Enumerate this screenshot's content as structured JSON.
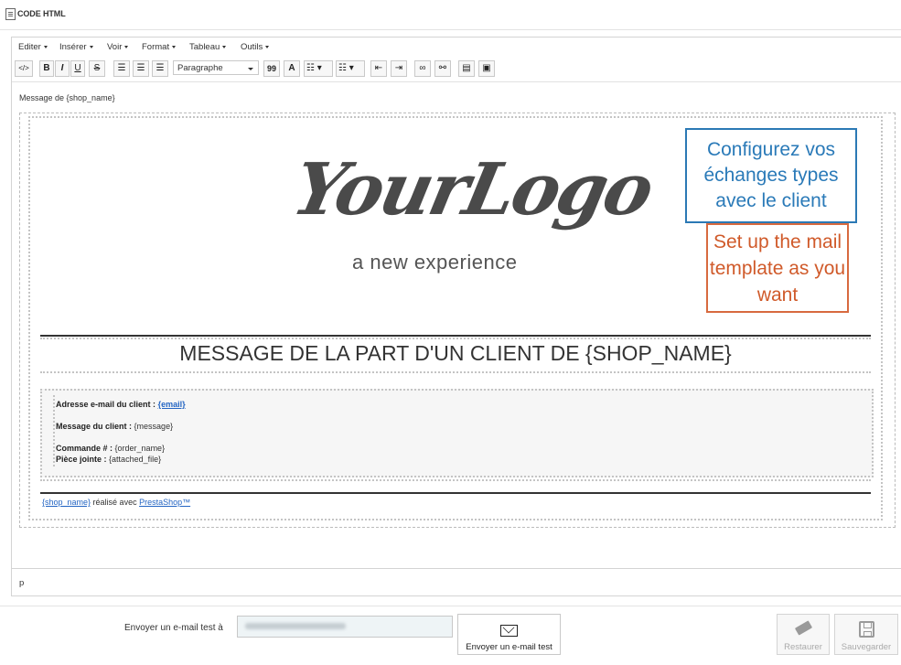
{
  "header": {
    "title": "CODE HTML"
  },
  "menubar": {
    "items": [
      "Editer",
      "Insérer",
      "Voir",
      "Format",
      "Tableau",
      "Outils"
    ]
  },
  "toolbar": {
    "bold": "B",
    "italic": "I",
    "underline": "U",
    "strike": "S",
    "format_select": "Paragraphe",
    "quote": "99",
    "font": "A"
  },
  "editor": {
    "message_label": "Message de {shop_name}",
    "logo_main": "YourLogo",
    "logo_sub": "a new experience",
    "callout_fr": "Configurez vos échanges types avec le client",
    "callout_en": "Set up the mail template as you want",
    "heading": "MESSAGE DE LA PART D'UN CLIENT DE {SHOP_NAME}",
    "details": {
      "email_label": "Adresse e-mail du client :",
      "email_value": "{email}",
      "message_label": "Message du client :",
      "message_value": "{message}",
      "order_label": "Commande # :",
      "order_value": "{order_name}",
      "attachment_label": "Pièce jointe :",
      "attachment_value": "{attached_file}"
    },
    "footer": {
      "shop_link": "{shop_name}",
      "middle": " réalisé avec ",
      "presta_link": "PrestaShop™"
    },
    "status_path": "p"
  },
  "bottom": {
    "send_label": "Envoyer un e-mail test à",
    "send_button": "Envoyer un e-mail test",
    "restore_button": "Restaurer",
    "save_button": "Sauvegarder"
  },
  "colors": {
    "callout_blue": "#2a7ab8",
    "callout_red": "#d05a2a",
    "link": "#2465c3"
  }
}
